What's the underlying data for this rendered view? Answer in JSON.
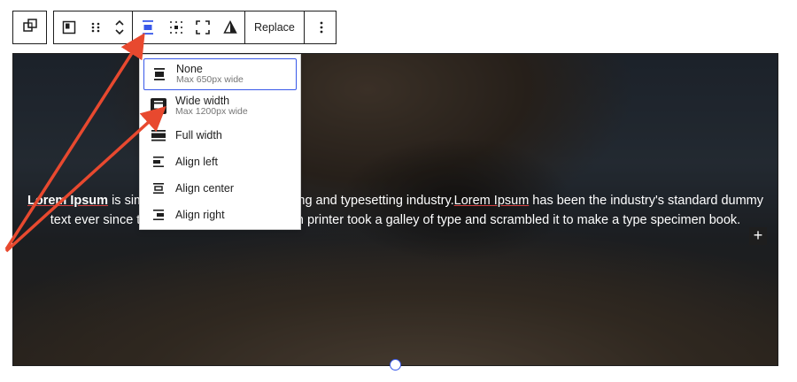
{
  "toolbar": {
    "replace_label": "Replace",
    "icons": [
      "block-transform-icon",
      "cover-block-icon",
      "drag-handle-icon",
      "move-up-down-icon",
      "align-icon",
      "content-position-icon",
      "fullscreen-icon",
      "contrast-icon",
      "more-options-icon"
    ]
  },
  "alignment_menu": {
    "items": [
      {
        "label": "None",
        "description": "Max 650px wide",
        "icon": "align-none-icon",
        "selected": true
      },
      {
        "label": "Wide width",
        "description": "Max 1200px wide",
        "icon": "align-wide-icon",
        "active": true
      },
      {
        "label": "Full width",
        "icon": "align-full-icon"
      },
      {
        "label": "Align left",
        "icon": "align-left-icon"
      },
      {
        "label": "Align center",
        "icon": "align-center-icon"
      },
      {
        "label": "Align right",
        "icon": "align-right-icon"
      }
    ]
  },
  "cover": {
    "text_part1": "Lorem Ipsum",
    "text_part2": " is simply dummy text of the printing and typesetting industry.",
    "text_part3": "Lorem Ipsum",
    "text_part4": " has been the industry's standard dummy text ever since the 1500s, when an unknown printer took a galley of type and scrambled it to make a type specimen book.",
    "plus_label": "+"
  },
  "colors": {
    "accent": "#3858e9",
    "annotation": "#e8492f",
    "dark": "#1e1e1e"
  }
}
